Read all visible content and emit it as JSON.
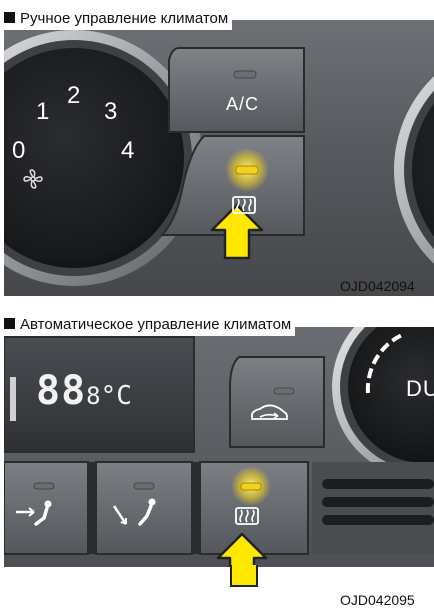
{
  "manual": {
    "title": "Ручное управление климатом",
    "fan_speeds": [
      "0",
      "1",
      "2",
      "3",
      "4"
    ],
    "ac_label": "A/C",
    "rear_defrost_indicator": "on",
    "fan_icon": "fan-icon",
    "defrost_icon": "rear-defrost-icon",
    "pointer_icon": "yellow-arrow-icon",
    "ref_code": "OJD042094"
  },
  "auto": {
    "title": "Автоматическое управление климатом",
    "temp_display": "88",
    "temp_unit": "°C",
    "temp_small": "8",
    "dial_label": "DU",
    "recirc_icon": "recirculation-car-icon",
    "mode_icons": [
      "face-vent-icon",
      "foot-vent-icon"
    ],
    "defrost_icon": "rear-defrost-icon",
    "rear_defrost_indicator": "on",
    "pointer_icon": "yellow-arrow-icon",
    "ref_code": "OJD042095"
  },
  "colors": {
    "indicator_on": "#f2d21c",
    "arrow_fill": "#ffe800",
    "panel_dark": "#3a3c40"
  }
}
